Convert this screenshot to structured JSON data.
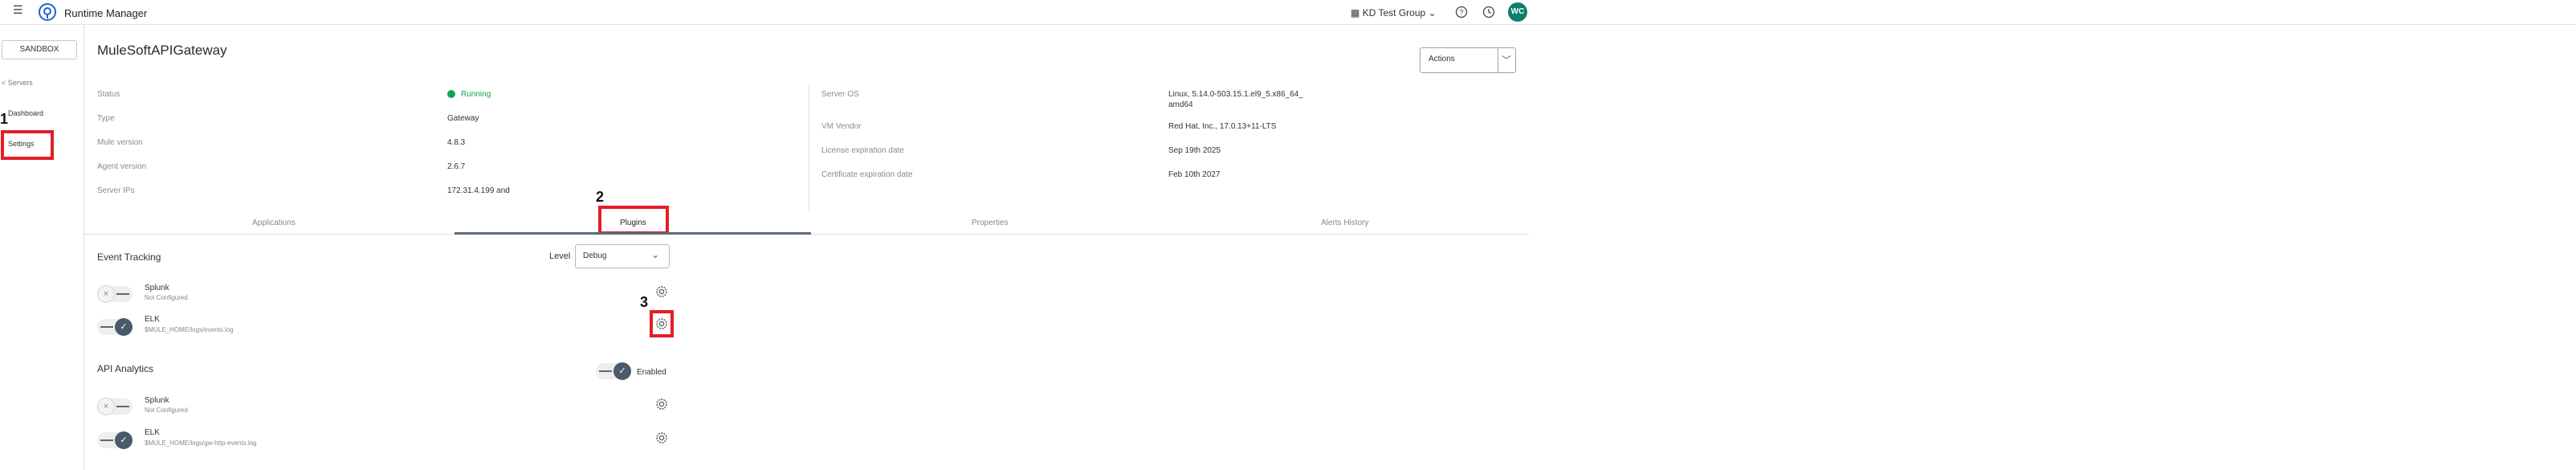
{
  "topbar": {
    "app_title": "Runtime Manager",
    "org_name": "KD Test Group",
    "avatar_initials": "WC",
    "icons": [
      "menu-icon",
      "runtime-manager-logo",
      "building-icon",
      "chevron-down-icon",
      "help-icon",
      "history-icon"
    ]
  },
  "sidebar": {
    "environment": "SANDBOX",
    "back_link": "< Servers",
    "items": [
      {
        "label": "Dashboard"
      },
      {
        "label": "Settings"
      }
    ]
  },
  "annotations": {
    "step1": "1",
    "step2": "2",
    "step3": "3",
    "highlight_color": "#e41e26"
  },
  "server": {
    "name": "MuleSoftAPIGateway",
    "actions_label": "Actions",
    "left_details": [
      {
        "label": "Status",
        "value": "Running"
      },
      {
        "label": "Type",
        "value": "Gateway"
      },
      {
        "label": "Mule version",
        "value": "4.8.3"
      },
      {
        "label": "Agent version",
        "value": "2.6.7"
      },
      {
        "label": "Server IPs",
        "value": "172.31.4.199 and"
      }
    ],
    "right_details": [
      {
        "label": "Server OS",
        "value_line1": "Linux, 5.14.0-503.15.1.el9_5.x86_64_",
        "value_line2": "amd64"
      },
      {
        "label": "VM Vendor",
        "value": "Red Hat, Inc., 17.0.13+11-LTS"
      },
      {
        "label": "License expiration date",
        "value": "Sep 19th 2025"
      },
      {
        "label": "Certificate expiration date",
        "value": "Feb 10th 2027"
      }
    ],
    "status_color": "#14a44d"
  },
  "tabs": [
    {
      "label": "Applications",
      "active": false
    },
    {
      "label": "Plugins",
      "active": true
    },
    {
      "label": "Properties",
      "active": false
    },
    {
      "label": "Alerts History",
      "active": false
    }
  ],
  "event_tracking": {
    "title": "Event Tracking",
    "level_label": "Level",
    "level_value": "Debug",
    "plugins": [
      {
        "name": "Splunk",
        "detail": "Not Configured",
        "enabled": false
      },
      {
        "name": "ELK",
        "detail": "$MULE_HOME/logs/events.log",
        "enabled": true
      }
    ]
  },
  "api_analytics": {
    "title": "API Analytics",
    "status_label": "Enabled",
    "enabled": true,
    "plugins": [
      {
        "name": "Splunk",
        "detail": "Not Configured",
        "enabled": false
      },
      {
        "name": "ELK",
        "detail": "$MULE_HOME/logs/gw-http-events.log",
        "enabled": true
      }
    ]
  }
}
